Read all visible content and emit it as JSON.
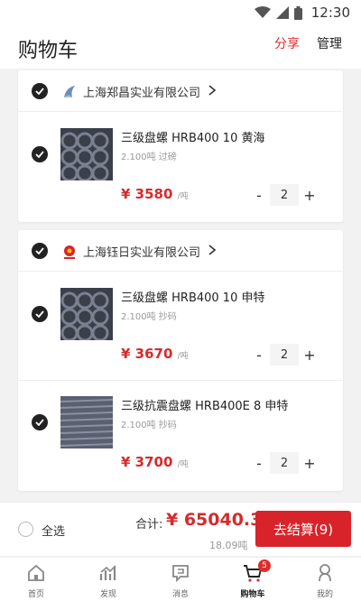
{
  "status": {
    "time": "12:30"
  },
  "header": {
    "title": "购物车",
    "share": "分享",
    "manage": "管理"
  },
  "shops": [
    {
      "name": "上海郑昌实业有限公司",
      "items": [
        {
          "title": "三级盘螺 HRB400 10 黄海",
          "sub": "2.100吨 过磅",
          "price": "¥ 3580",
          "unit": "/吨",
          "qty": "2"
        }
      ]
    },
    {
      "name": "上海钰日实业有限公司",
      "items": [
        {
          "title": "三级盘螺 HRB400 10 申特",
          "sub": "2.100吨 抄码",
          "price": "¥ 3670",
          "unit": "/吨",
          "qty": "2"
        },
        {
          "title": "三级抗震盘螺 HRB400E 8 申特",
          "sub": "2.100吨 抄码",
          "price": "¥ 3700",
          "unit": "/吨",
          "qty": "2"
        }
      ]
    }
  ],
  "qty_controls": {
    "minus": "-",
    "plus": "+"
  },
  "checkout": {
    "select_all": "全选",
    "total_label": "合计:",
    "total": "¥ 65040.3",
    "weight": "18.09吨",
    "button": "去结算(9)"
  },
  "tabs": [
    {
      "label": "首页",
      "icon": "home-icon"
    },
    {
      "label": "发现",
      "icon": "chart-icon"
    },
    {
      "label": "消息",
      "icon": "message-icon"
    },
    {
      "label": "购物车",
      "icon": "cart-icon",
      "badge": "5",
      "active": true
    },
    {
      "label": "我的",
      "icon": "user-icon"
    }
  ],
  "colors": {
    "accent": "#d8232a",
    "price": "#d62b2b",
    "text": "#222222",
    "muted": "#999999"
  }
}
